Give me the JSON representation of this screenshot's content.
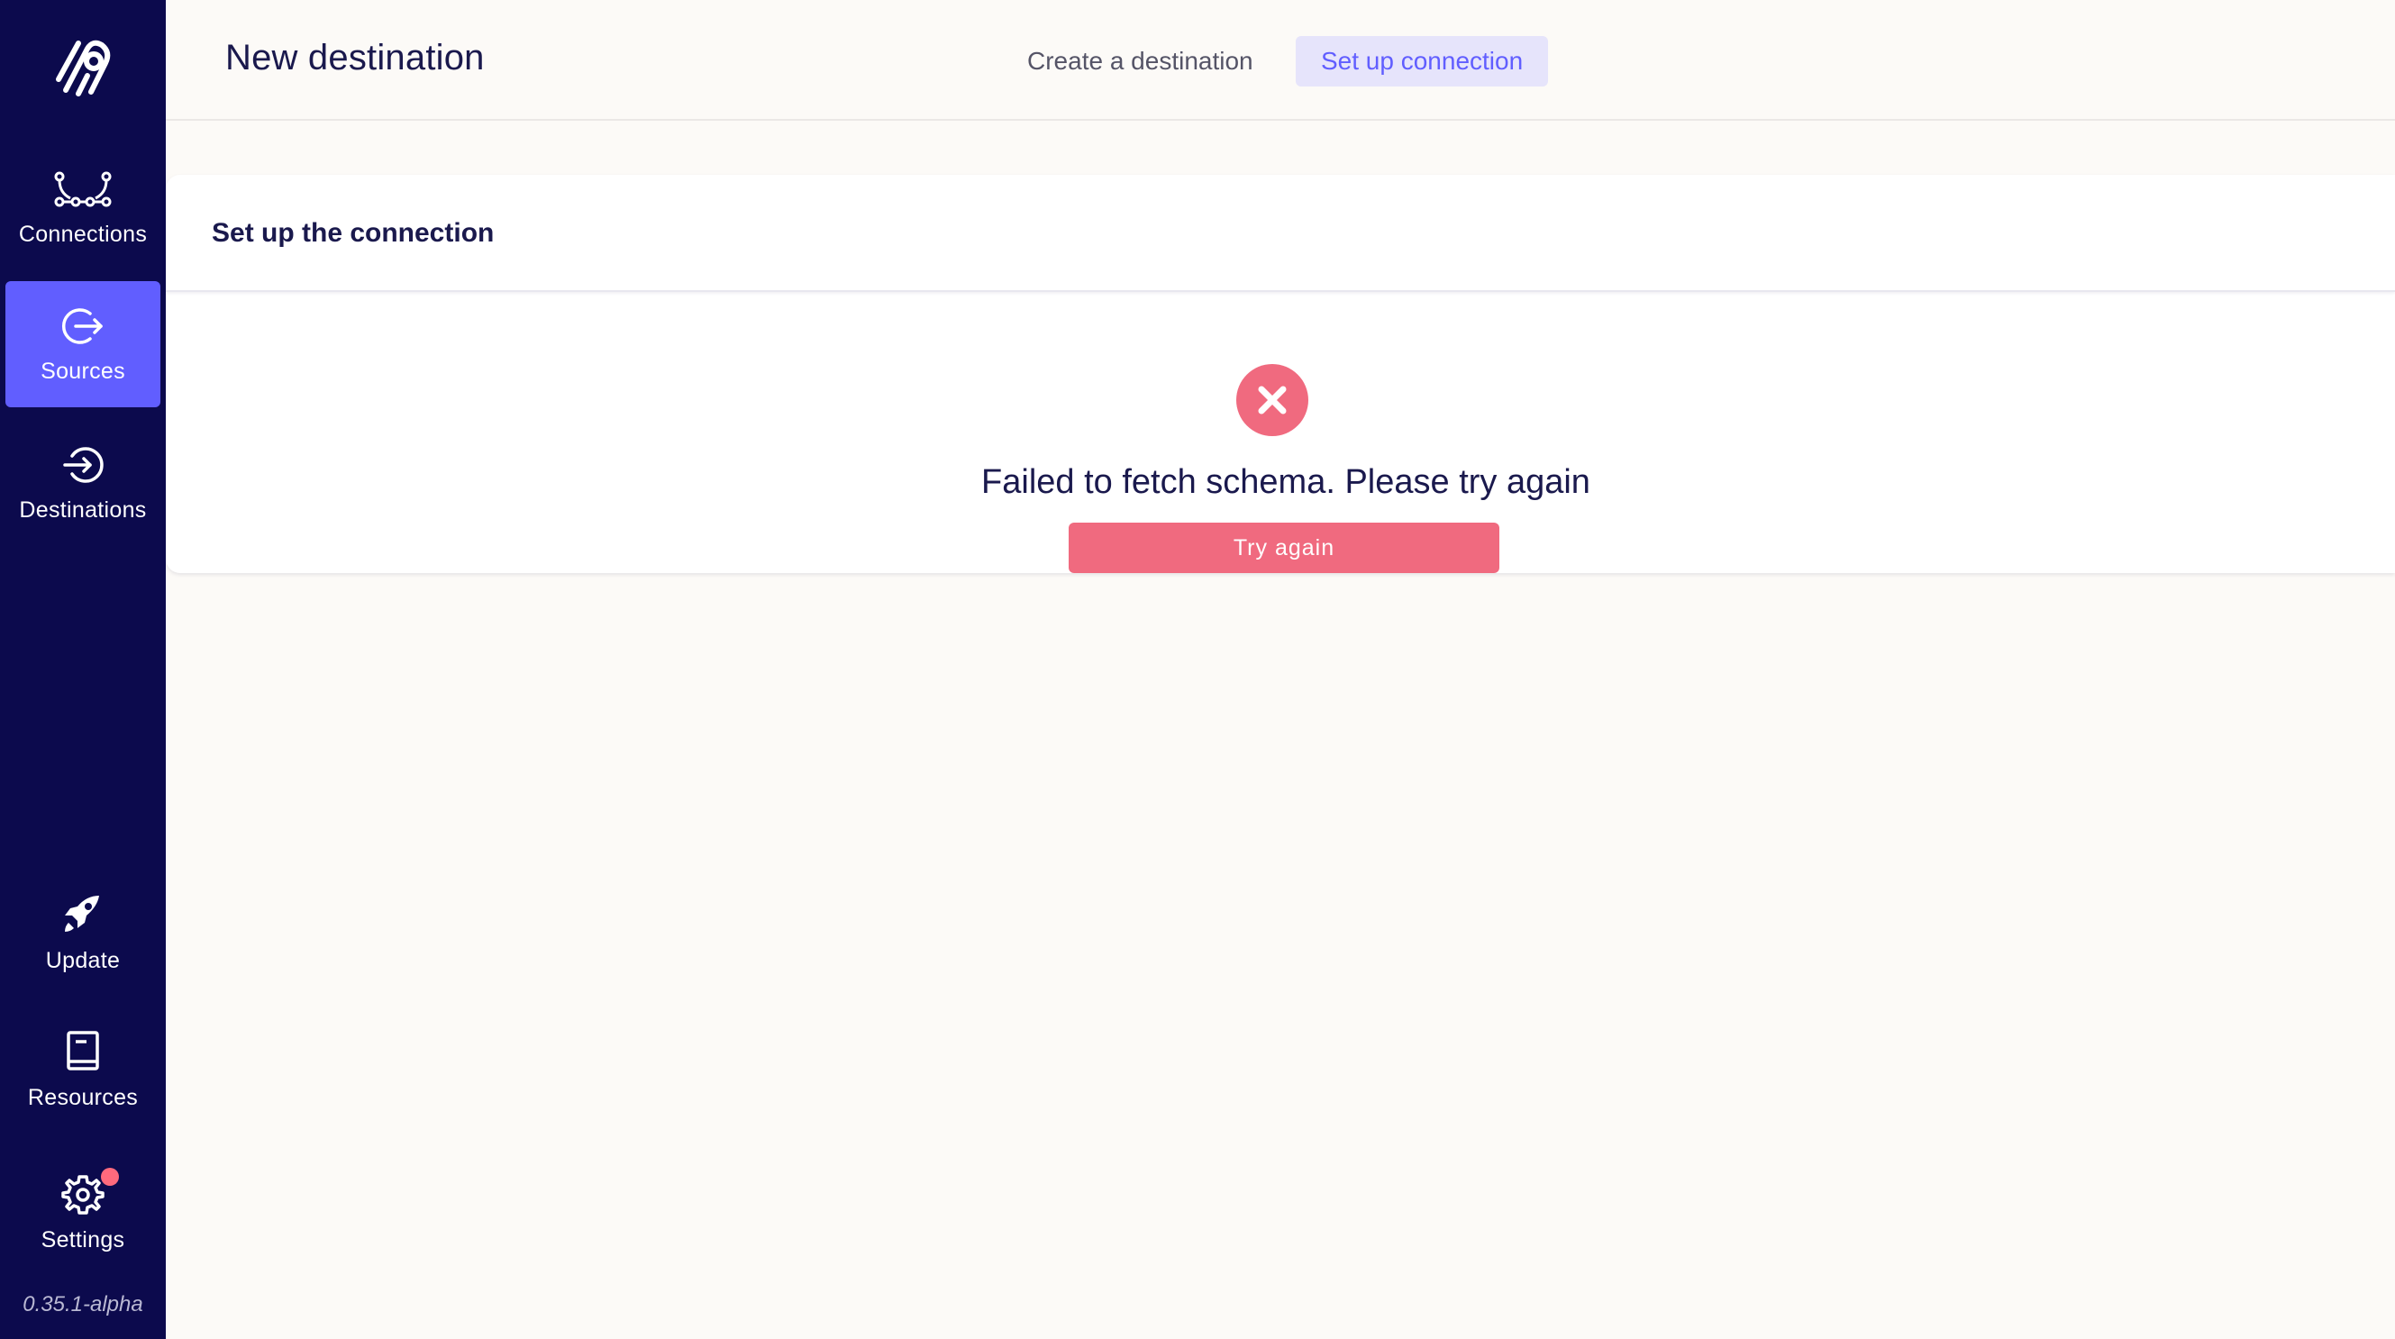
{
  "sidebar": {
    "logo": "airbyte-logo-icon",
    "items": [
      {
        "label": "Connections",
        "icon": "connections-icon",
        "active": false
      },
      {
        "label": "Sources",
        "icon": "sources-icon",
        "active": true
      },
      {
        "label": "Destinations",
        "icon": "destinations-icon",
        "active": false
      },
      {
        "label": "Update",
        "icon": "rocket-icon",
        "active": false
      },
      {
        "label": "Resources",
        "icon": "book-icon",
        "active": false
      },
      {
        "label": "Settings",
        "icon": "gear-icon",
        "active": false,
        "notification": true
      }
    ],
    "version": "0.35.1-alpha"
  },
  "header": {
    "title": "New destination",
    "steps": [
      {
        "label": "Create a destination",
        "active": false
      },
      {
        "label": "Set up connection",
        "active": true
      }
    ]
  },
  "card": {
    "title": "Set up the connection",
    "error_message": "Failed to fetch schema. Please try again",
    "retry_label": "Try again"
  },
  "colors": {
    "sidebar_bg": "#0c0a4d",
    "accent": "#615eff",
    "error": "#f06a7f",
    "page_bg": "#fcfaf7",
    "text_dark": "#1a194d"
  }
}
